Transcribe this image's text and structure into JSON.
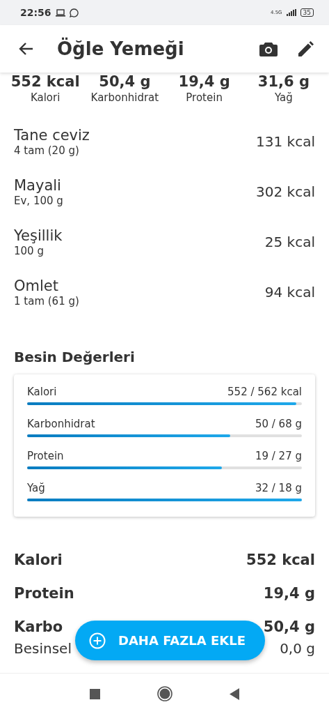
{
  "status_bar": {
    "time": "22:56",
    "network": "4.5G",
    "battery": "35"
  },
  "app_bar": {
    "title": "Öğle Yemeği"
  },
  "summary": [
    {
      "value": "552 kcal",
      "label": "Kalori"
    },
    {
      "value": "50,4 g",
      "label": "Karbonhidrat"
    },
    {
      "value": "19,4 g",
      "label": "Protein"
    },
    {
      "value": "31,6 g",
      "label": "Yağ"
    }
  ],
  "foods": [
    {
      "name": "Tane ceviz",
      "portion": "4 tam (20 g)",
      "calories": "131 kcal"
    },
    {
      "name": "Mayali",
      "portion": "Ev, 100 g",
      "calories": "302 kcal"
    },
    {
      "name": "Yeşillik",
      "portion": "100 g",
      "calories": "25 kcal"
    },
    {
      "name": "Omlet",
      "portion": "1 tam (61 g)",
      "calories": "94 kcal"
    }
  ],
  "nutrition": {
    "title": "Besin Değerleri",
    "bars": [
      {
        "label": "Kalori",
        "reading": "552 / 562 kcal",
        "level": 0.98
      },
      {
        "label": "Karbonhidrat",
        "reading": "50 / 68 g",
        "level": 0.74
      },
      {
        "label": "Protein",
        "reading": "19 / 27 g",
        "level": 0.71
      },
      {
        "label": "Yağ",
        "reading": "32 / 18 g",
        "level": 1
      }
    ]
  },
  "totals": [
    {
      "label": "Kalori",
      "value": "552 kcal",
      "kind": "main"
    },
    {
      "label": "Protein",
      "value": "19,4 g",
      "kind": "main"
    },
    {
      "label": "Karbo",
      "value": "50,4 g",
      "kind": "main"
    },
    {
      "label": "Besinsel",
      "value": "0,0 g",
      "kind": "sub"
    }
  ],
  "fab": {
    "label": "DAHA FAZLA EKLE"
  }
}
